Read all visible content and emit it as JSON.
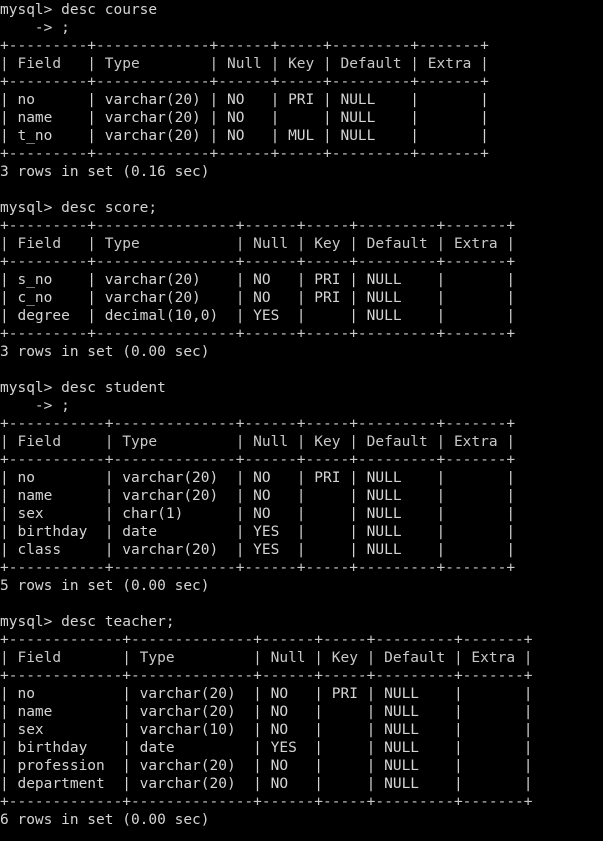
{
  "terminal": {
    "app": "mysql-command-line-client",
    "background_color": "#000000",
    "foreground_color": "#d4d4d4",
    "prompt": "mysql>",
    "continuation_prompt": "    ->",
    "columns_headers": [
      "Field",
      "Type",
      "Null",
      "Key",
      "Default",
      "Extra"
    ]
  },
  "blocks": [
    {
      "id": "desc-course",
      "command_lines": [
        "mysql> desc course",
        "    -> ;"
      ],
      "table": {
        "headers": [
          "Field",
          "Type",
          "Null",
          "Key",
          "Default",
          "Extra"
        ],
        "widths": [
          9,
          13,
          6,
          5,
          9,
          7
        ],
        "rows": [
          [
            "no",
            "varchar(20)",
            "NO",
            "PRI",
            "NULL",
            ""
          ],
          [
            "name",
            "varchar(20)",
            "NO",
            "",
            "NULL",
            ""
          ],
          [
            "t_no",
            "varchar(20)",
            "NO",
            "MUL",
            "NULL",
            ""
          ]
        ]
      },
      "status": "3 rows in set (0.16 sec)"
    },
    {
      "id": "desc-score",
      "command_lines": [
        "mysql> desc score;"
      ],
      "table": {
        "headers": [
          "Field",
          "Type",
          "Null",
          "Key",
          "Default",
          "Extra"
        ],
        "widths": [
          9,
          16,
          6,
          5,
          9,
          7
        ],
        "rows": [
          [
            "s_no",
            "varchar(20)",
            "NO",
            "PRI",
            "NULL",
            ""
          ],
          [
            "c_no",
            "varchar(20)",
            "NO",
            "PRI",
            "NULL",
            ""
          ],
          [
            "degree",
            "decimal(10,0)",
            "YES",
            "",
            "NULL",
            ""
          ]
        ]
      },
      "status": "3 rows in set (0.00 sec)"
    },
    {
      "id": "desc-student",
      "command_lines": [
        "mysql> desc student",
        "    -> ;"
      ],
      "table": {
        "headers": [
          "Field",
          "Type",
          "Null",
          "Key",
          "Default",
          "Extra"
        ],
        "widths": [
          11,
          14,
          6,
          5,
          9,
          7
        ],
        "rows": [
          [
            "no",
            "varchar(20)",
            "NO",
            "PRI",
            "NULL",
            ""
          ],
          [
            "name",
            "varchar(20)",
            "NO",
            "",
            "NULL",
            ""
          ],
          [
            "sex",
            "char(1)",
            "NO",
            "",
            "NULL",
            ""
          ],
          [
            "birthday",
            "date",
            "YES",
            "",
            "NULL",
            ""
          ],
          [
            "class",
            "varchar(20)",
            "YES",
            "",
            "NULL",
            ""
          ]
        ]
      },
      "status": "5 rows in set (0.00 sec)"
    },
    {
      "id": "desc-teacher",
      "command_lines": [
        "mysql> desc teacher;"
      ],
      "table": {
        "headers": [
          "Field",
          "Type",
          "Null",
          "Key",
          "Default",
          "Extra"
        ],
        "widths": [
          13,
          14,
          6,
          5,
          9,
          7
        ],
        "rows": [
          [
            "no",
            "varchar(20)",
            "NO",
            "PRI",
            "NULL",
            ""
          ],
          [
            "name",
            "varchar(20)",
            "NO",
            "",
            "NULL",
            ""
          ],
          [
            "sex",
            "varchar(10)",
            "NO",
            "",
            "NULL",
            ""
          ],
          [
            "birthday",
            "date",
            "YES",
            "",
            "NULL",
            ""
          ],
          [
            "profession",
            "varchar(20)",
            "NO",
            "",
            "NULL",
            ""
          ],
          [
            "department",
            "varchar(20)",
            "NO",
            "",
            "NULL",
            ""
          ]
        ]
      },
      "status": "6 rows in set (0.00 sec)"
    }
  ]
}
